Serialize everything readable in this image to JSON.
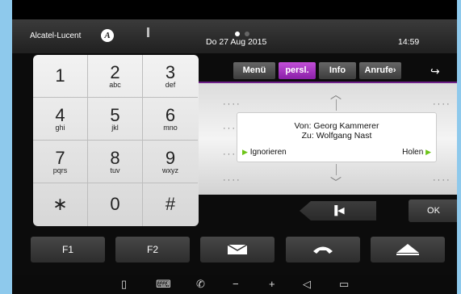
{
  "header": {
    "brand": "Alcatel-Lucent",
    "brand_logo": "A",
    "date": "Do 27 Aug 2015",
    "time": "14:59"
  },
  "keypad": {
    "keys": [
      {
        "digit": "1",
        "letters": ""
      },
      {
        "digit": "2",
        "letters": "abc"
      },
      {
        "digit": "3",
        "letters": "def"
      },
      {
        "digit": "4",
        "letters": "ghi"
      },
      {
        "digit": "5",
        "letters": "jkl"
      },
      {
        "digit": "6",
        "letters": "mno"
      },
      {
        "digit": "7",
        "letters": "pqrs"
      },
      {
        "digit": "8",
        "letters": "tuv"
      },
      {
        "digit": "9",
        "letters": "wxyz"
      },
      {
        "digit": "∗",
        "letters": ""
      },
      {
        "digit": "0",
        "letters": ""
      },
      {
        "digit": "#",
        "letters": ""
      }
    ]
  },
  "tabs": [
    {
      "label": "Menü",
      "active": false
    },
    {
      "label": "persl.",
      "active": true
    },
    {
      "label": "Info",
      "active": false
    },
    {
      "label": "Anrufe",
      "active": false
    }
  ],
  "popup": {
    "from": "Von: Georg Kammerer",
    "to": "Zu: Wolfgang Nast",
    "ignore_label": "Ignorieren",
    "accept_label": "Holen"
  },
  "nav": {
    "ok_label": "OK"
  },
  "function_keys": {
    "f1": "F1",
    "f2": "F2"
  },
  "bottom_icons": [
    "page-icon",
    "keyboard-icon",
    "handset-icon",
    "volume-minus-icon",
    "volume-plus-icon",
    "speaker-icon",
    "screen-icon"
  ],
  "colors": {
    "accent": "#9c2bbf",
    "accept_arrow": "#6cc417"
  }
}
